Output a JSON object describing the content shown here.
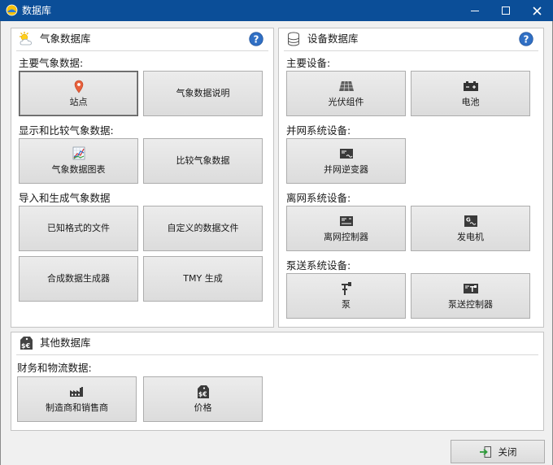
{
  "window": {
    "title": "数据库"
  },
  "weather_panel": {
    "title": "气象数据库",
    "sections": {
      "main": "主要气象数据:",
      "display": "显示和比较气象数据:",
      "import": "导入和生成气象数据"
    },
    "buttons": {
      "sites": "站点",
      "description": "气象数据说明",
      "charts": "气象数据图表",
      "compare": "比较气象数据",
      "known_format": "已知格式的文件",
      "custom_file": "自定义的数据文件",
      "synthetic": "合成数据生成器",
      "tmy": "TMY 生成"
    }
  },
  "equipment_panel": {
    "title": "设备数据库",
    "sections": {
      "main": "主要设备:",
      "grid": "并网系统设备:",
      "offgrid": "离网系统设备:",
      "pump": "泵送系统设备:"
    },
    "buttons": {
      "pv_module": "光伏组件",
      "battery": "电池",
      "grid_inverter": "并网逆变器",
      "offgrid_controller": "离网控制器",
      "generator": "发电机",
      "pump": "泵",
      "pump_controller": "泵送控制器"
    }
  },
  "other_panel": {
    "title": "其他数据库",
    "sections": {
      "finance": "财务和物流数据:"
    },
    "buttons": {
      "manufacturers": "制造商和销售商",
      "prices": "价格"
    }
  },
  "footer": {
    "close_label": "关闭"
  }
}
